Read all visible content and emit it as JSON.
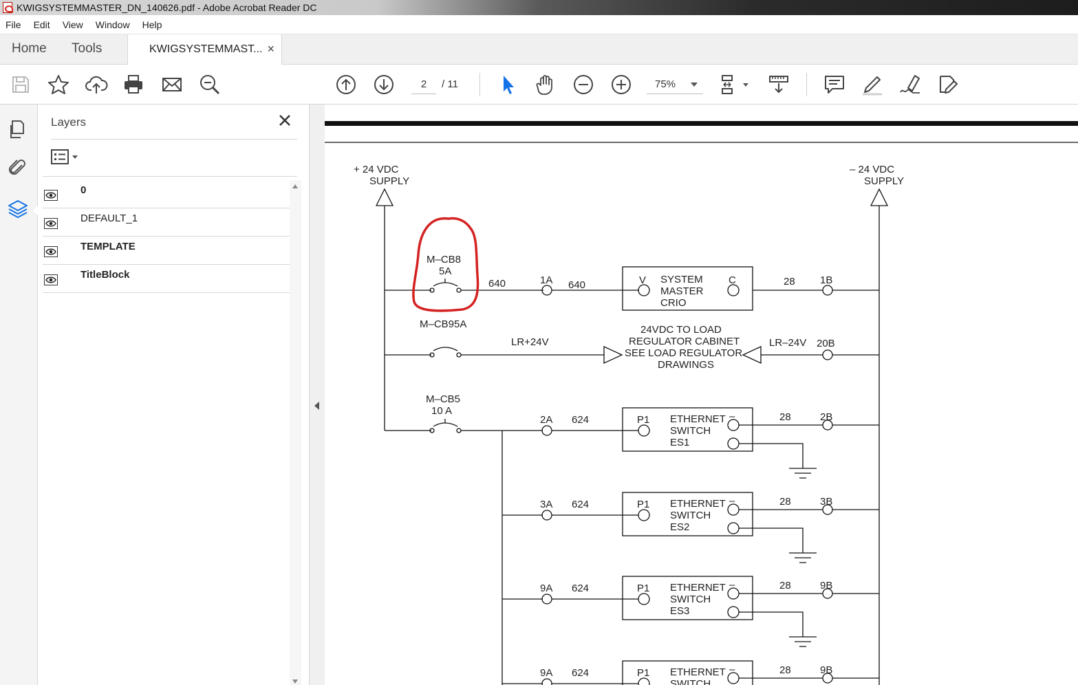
{
  "window": {
    "title": "KWIGSYSTEMMASTER_DN_140626.pdf - Adobe Acrobat Reader DC"
  },
  "menu": {
    "file": "File",
    "edit": "Edit",
    "view": "View",
    "window": "Window",
    "help": "Help"
  },
  "tabs": {
    "home": "Home",
    "tools": "Tools",
    "document": "KWIGSYSTEMMAST...",
    "close": "×"
  },
  "toolbar": {
    "page_current": "2",
    "page_total": "/ 11",
    "zoom": "75%"
  },
  "layers": {
    "title": "Layers",
    "items": [
      {
        "name": "0",
        "bold": true
      },
      {
        "name": "DEFAULT_1",
        "bold": false
      },
      {
        "name": "TEMPLATE",
        "bold": true
      },
      {
        "name": "TitleBlock",
        "bold": true
      }
    ]
  },
  "schematic": {
    "pos_supply_1": "+  24  VDC",
    "pos_supply_2": "SUPPLY",
    "neg_supply_1": "–  24  VDC",
    "neg_supply_2": "SUPPLY",
    "cb8_1": "M–CB8",
    "cb8_2": "5A",
    "wire_640a": "640",
    "t_1a": "1A",
    "wire_640b": "640",
    "crio_v": "V",
    "crio_1": "SYSTEM",
    "crio_2": "MASTER",
    "crio_3": "CRIO",
    "crio_c": "C",
    "wire_28a": "28",
    "t_1b": "1B",
    "cb95": "M–CB95A",
    "lr_pos": "LR+24V",
    "lr_1": "24VDC  TO  LOAD",
    "lr_2": "REGULATOR  CABINET",
    "lr_3": "SEE  LOAD  REGULATOR",
    "lr_4": "DRAWINGS",
    "lr_neg": "LR–24V",
    "t_20b": "20B",
    "cb5_1": "M–CB5",
    "cb5_2": "10  A",
    "switches": [
      {
        "t_a": "2A",
        "wire": "624",
        "p1": "P1",
        "l1": "ETHERNET",
        "l2": "SWITCH",
        "l3": "ES1",
        "minus": "–",
        "wire28": "28",
        "t_b": "2B"
      },
      {
        "t_a": "3A",
        "wire": "624",
        "p1": "P1",
        "l1": "ETHERNET",
        "l2": "SWITCH",
        "l3": "ES2",
        "minus": "–",
        "wire28": "28",
        "t_b": "3B"
      },
      {
        "t_a": "9A",
        "wire": "624",
        "p1": "P1",
        "l1": "ETHERNET",
        "l2": "SWITCH",
        "l3": "ES3",
        "minus": "–",
        "wire28": "28",
        "t_b": "9B"
      },
      {
        "t_a": "9A",
        "wire": "624",
        "p1": "P1",
        "l1": "ETHERNET",
        "l2": "SWITCH",
        "l3": "",
        "minus": "–",
        "wire28": "28",
        "t_b": "9B"
      }
    ]
  }
}
